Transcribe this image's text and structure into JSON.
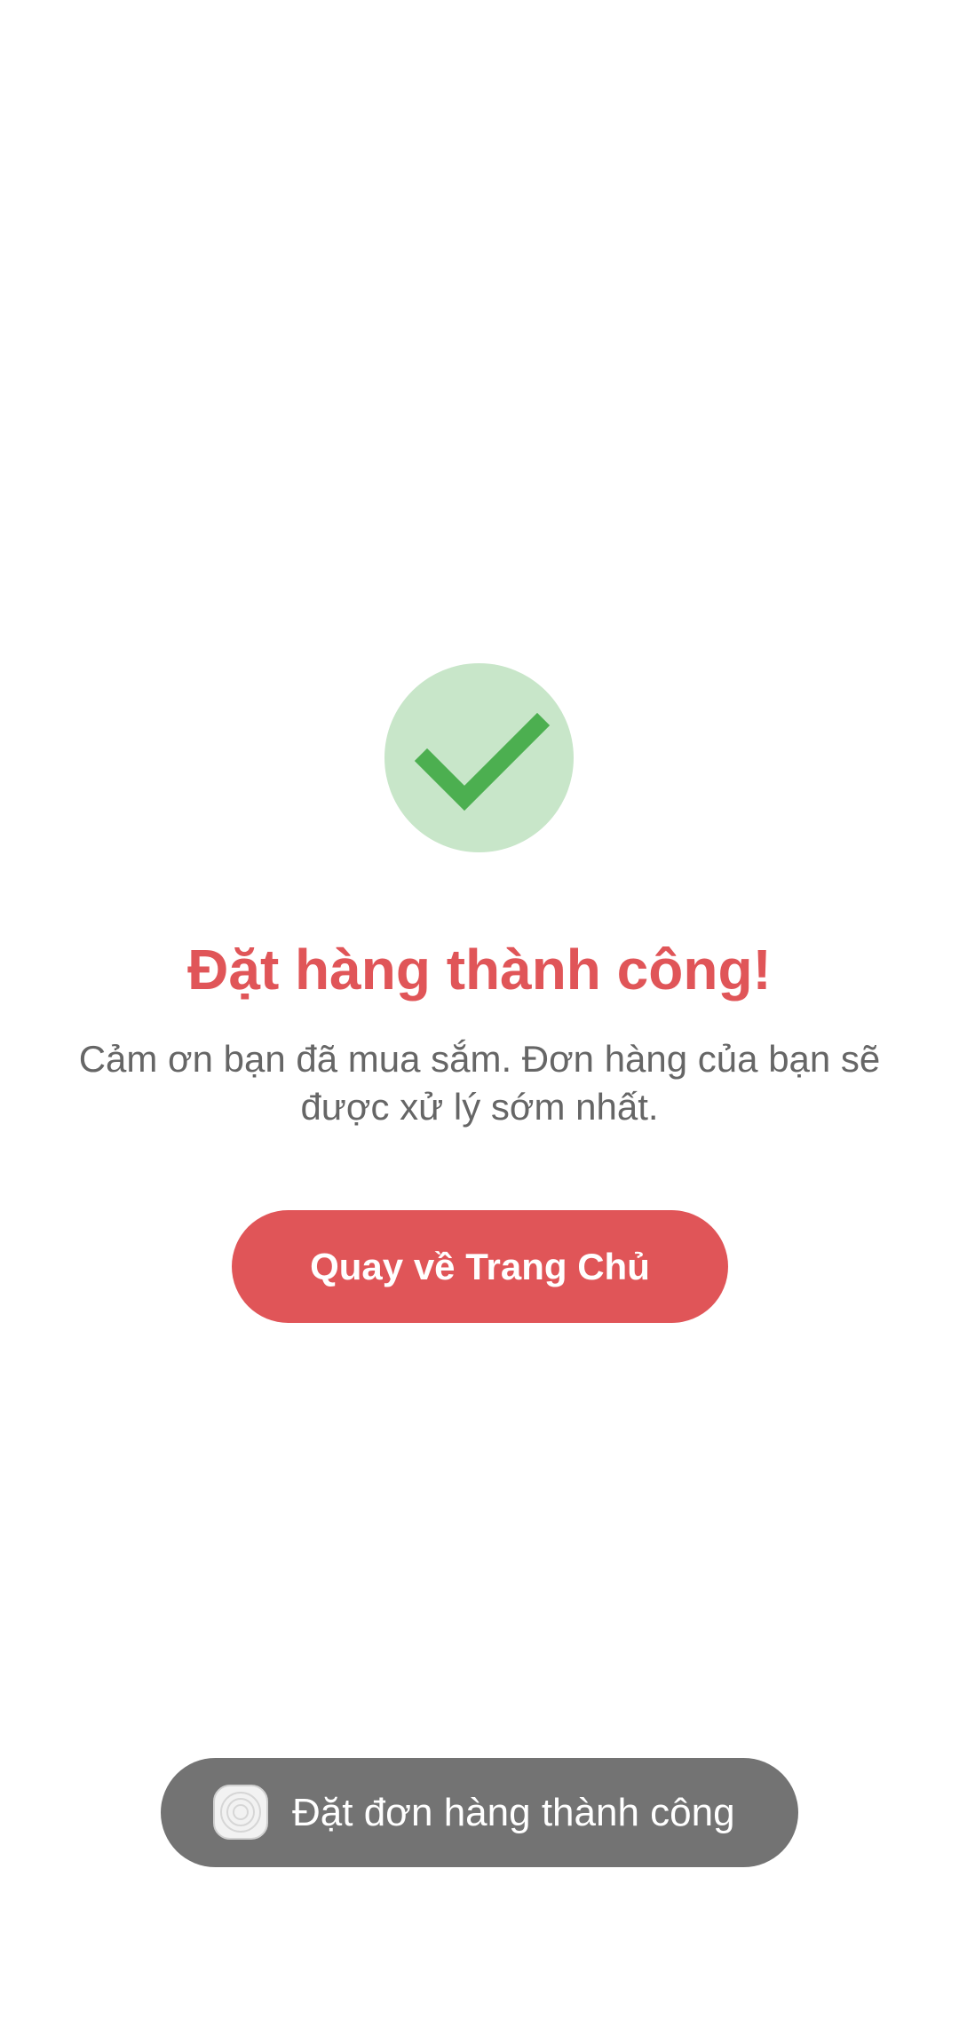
{
  "success": {
    "icon": "checkmark-icon",
    "title": "Đặt hàng thành công!",
    "message": "Cảm ơn bạn đã mua sắm. Đơn hàng của bạn sẽ được xử lý sớm nhất.",
    "button_label": "Quay về Trang Chủ"
  },
  "toast": {
    "icon": "app-icon",
    "text": "Đặt đơn hàng thành công"
  },
  "colors": {
    "accent": "#e05558",
    "success_bg": "#c8e6c9",
    "success_check": "#4caf50",
    "message_text": "#666666",
    "toast_bg": "#737373"
  }
}
